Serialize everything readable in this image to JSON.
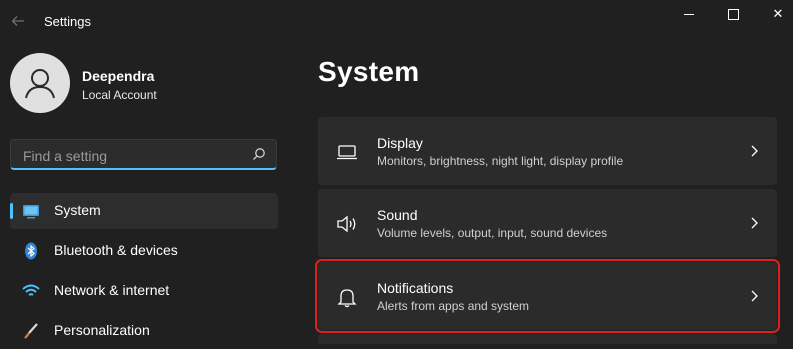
{
  "window": {
    "title": "Settings",
    "controls": {
      "minimize": "minimize",
      "maximize": "maximize",
      "close": "✕"
    }
  },
  "profile": {
    "name": "Deependra",
    "account_type": "Local Account"
  },
  "search": {
    "placeholder": "Find a setting",
    "value": ""
  },
  "sidebar": {
    "items": [
      {
        "label": "System",
        "icon": "monitor-icon",
        "selected": true
      },
      {
        "label": "Bluetooth & devices",
        "icon": "bluetooth-icon",
        "selected": false
      },
      {
        "label": "Network & internet",
        "icon": "wifi-icon",
        "selected": false
      },
      {
        "label": "Personalization",
        "icon": "brush-icon",
        "selected": false
      }
    ]
  },
  "main": {
    "title": "System",
    "cards": [
      {
        "title": "Display",
        "subtitle": "Monitors, brightness, night light, display profile",
        "icon": "laptop-icon"
      },
      {
        "title": "Sound",
        "subtitle": "Volume levels, output, input, sound devices",
        "icon": "speaker-icon"
      },
      {
        "title": "Notifications",
        "subtitle": "Alerts from apps and system",
        "icon": "bell-icon",
        "highlighted": true
      }
    ]
  },
  "colors": {
    "background": "#202020",
    "card": "#2b2b2b",
    "accent": "#4cc2ff",
    "highlight_border": "#e0201e"
  }
}
